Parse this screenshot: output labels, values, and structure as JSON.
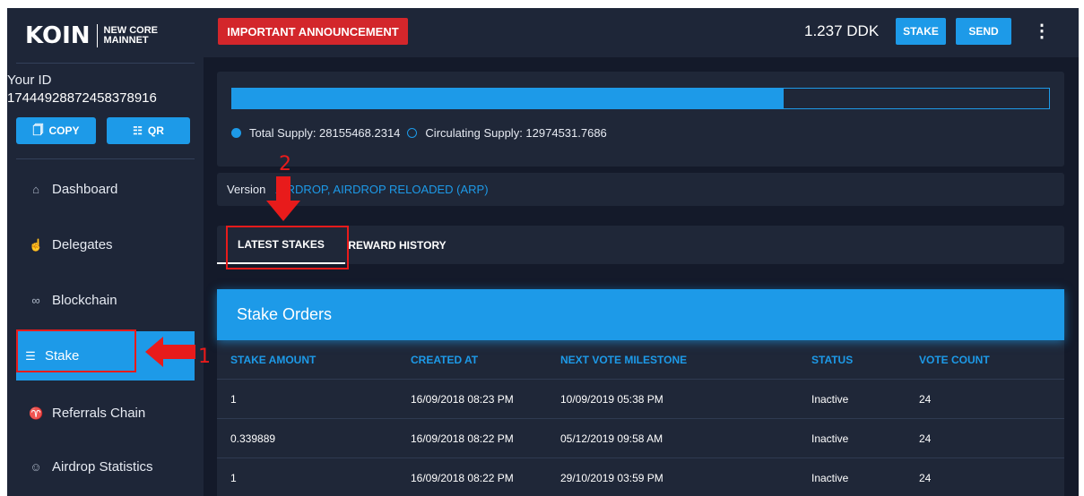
{
  "brand": {
    "name": "KOIN",
    "tag_line1": "NEW CORE",
    "tag_line2": "MAINNET"
  },
  "account": {
    "id_label": "Your ID",
    "id": "17444928872458378916",
    "copy_label": "COPY",
    "qr_label": "QR"
  },
  "nav": [
    {
      "label": "Dashboard",
      "icon": "home-icon"
    },
    {
      "label": "Delegates",
      "icon": "thumbs-up-icon"
    },
    {
      "label": "Blockchain",
      "icon": "link-icon"
    },
    {
      "label": "Stake",
      "icon": "database-icon",
      "active": true
    },
    {
      "label": "Referrals Chain",
      "icon": "sitemap-icon"
    },
    {
      "label": "Airdrop Statistics",
      "icon": "user-plus-icon"
    }
  ],
  "topbar": {
    "announcement": "IMPORTANT ANNOUNCEMENT",
    "balance": "1.237 DDK",
    "stake_label": "STAKE",
    "send_label": "SEND",
    "more_label": "⋮"
  },
  "supply": {
    "total_label": "Total Supply: 28155468.2314",
    "circulating_label": "Circulating Supply: 12974531.7686",
    "circulating_fraction": 0.675
  },
  "version": {
    "label": "Version",
    "value": "AIRDROP, AIRDROP RELOADED (ARP)"
  },
  "tabs": [
    {
      "label": "LATEST STAKES",
      "active": true
    },
    {
      "label": "REWARD HISTORY"
    }
  ],
  "stake_orders": {
    "title": "Stake Orders",
    "columns": [
      "STAKE AMOUNT",
      "CREATED AT",
      "NEXT VOTE MILESTONE",
      "STATUS",
      "VOTE COUNT"
    ],
    "rows": [
      [
        "1",
        "16/09/2018 08:23 PM",
        "10/09/2019 05:38 PM",
        "Inactive",
        "24"
      ],
      [
        "0.339889",
        "16/09/2018 08:22 PM",
        "05/12/2019 09:58 AM",
        "Inactive",
        "24"
      ],
      [
        "1",
        "16/09/2018 08:22 PM",
        "29/10/2019 03:59 PM",
        "Inactive",
        "24"
      ]
    ]
  },
  "annotations": {
    "step1": "1",
    "step2": "2"
  },
  "colors": {
    "accent": "#1d9ae8",
    "announcement": "#d3262b",
    "annotation": "#e81b1b",
    "background": "#141a2a",
    "panel": "#1f2738"
  }
}
